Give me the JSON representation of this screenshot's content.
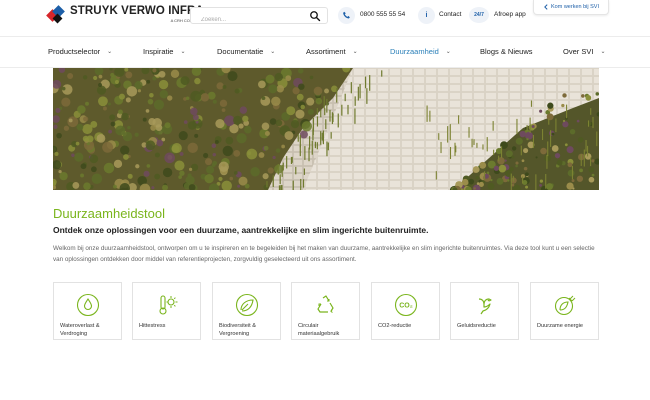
{
  "header": {
    "logo_title": "STRUYK VERWO INFRA",
    "logo_sub": "A CRH COMPANY",
    "search_placeholder": "Zoeken...",
    "phone": "0800 555 55 54",
    "contact": "Contact",
    "badge": "24/7",
    "afroep": "Afroep app",
    "werken": "Kom werken bij SVI"
  },
  "nav": [
    {
      "label": "Productselector",
      "has_chevron": true,
      "active": false
    },
    {
      "label": "Inspiratie",
      "has_chevron": true,
      "active": false
    },
    {
      "label": "Documentatie",
      "has_chevron": true,
      "active": false
    },
    {
      "label": "Assortiment",
      "has_chevron": true,
      "active": false
    },
    {
      "label": "Duurzaamheid",
      "has_chevron": true,
      "active": true
    },
    {
      "label": "Blogs & Nieuws",
      "has_chevron": false,
      "active": false
    },
    {
      "label": "Over SVI",
      "has_chevron": true,
      "active": false
    }
  ],
  "main": {
    "title": "Duurzaamheidstool",
    "subtitle": "Ontdek onze oplossingen voor een duurzame, aantrekkelijke en slim ingerichte buitenruimte.",
    "intro": "Welkom bij onze duurzaamheidstool, ontworpen om u te inspireren en te begeleiden bij het maken van duurzame, aantrekkelijke en slim ingerichte buitenruimtes. Via deze tool kunt u een selectie van oplossingen ontdekken door middel van referentieprojecten, zorgvuldig geselecteerd uit ons assortiment."
  },
  "tiles": [
    {
      "label": "Wateroverlast & Verdroging",
      "icon": "water-drop-icon"
    },
    {
      "label": "Hittestress",
      "icon": "thermometer-sun-icon"
    },
    {
      "label": "Biodiversiteit & Vergroening",
      "icon": "leaf-icon"
    },
    {
      "label": "Circulair materiaalgebruik",
      "icon": "recycle-icon"
    },
    {
      "label": "CO2-reductie",
      "icon": "co2-icon"
    },
    {
      "label": "Geluidsreductie",
      "icon": "bird-icon"
    },
    {
      "label": "Duurzame energie",
      "icon": "eco-plug-icon"
    }
  ],
  "colors": {
    "accent_green": "#7ab51d",
    "nav_active": "#2a7fb8",
    "brand_blue": "#1d5fa8",
    "brand_red": "#d6262b"
  },
  "chevron": "⌄",
  "icon_glyph": "i"
}
